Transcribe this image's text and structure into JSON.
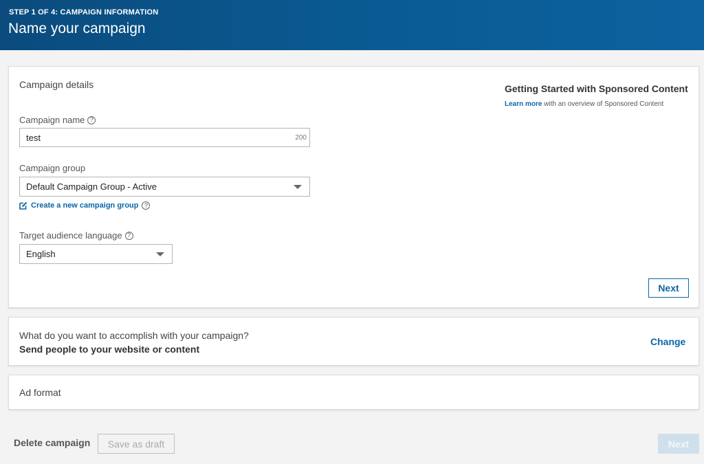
{
  "header": {
    "step": "STEP 1 OF 4: CAMPAIGN INFORMATION",
    "title": "Name your campaign"
  },
  "details": {
    "section_title": "Campaign details",
    "campaign_name": {
      "label": "Campaign name",
      "value": "test",
      "char_limit": "200"
    },
    "campaign_group": {
      "label": "Campaign group",
      "selected": "Default Campaign Group - Active",
      "create_link": "Create a new campaign group"
    },
    "language": {
      "label": "Target audience language",
      "selected": "English"
    },
    "next_label": "Next",
    "sidebar": {
      "title": "Getting Started with Sponsored Content",
      "learn_more": "Learn more",
      "learn_more_suffix": " with an overview of Sponsored Content"
    }
  },
  "objective": {
    "question": "What do you want to accomplish with your campaign?",
    "answer": "Send people to your website or content",
    "change_label": "Change"
  },
  "ad_format": {
    "label": "Ad format"
  },
  "footer": {
    "delete_label": "Delete campaign",
    "draft_label": "Save as draft",
    "next_label": "Next"
  },
  "colors": {
    "header_bg": "#0a5a92",
    "link": "#0b66a8",
    "next_disabled_bg": "#cfe0ec"
  },
  "icons": {
    "help": "question-circle-icon",
    "dropdown": "caret-down-icon",
    "create": "edit-icon"
  }
}
